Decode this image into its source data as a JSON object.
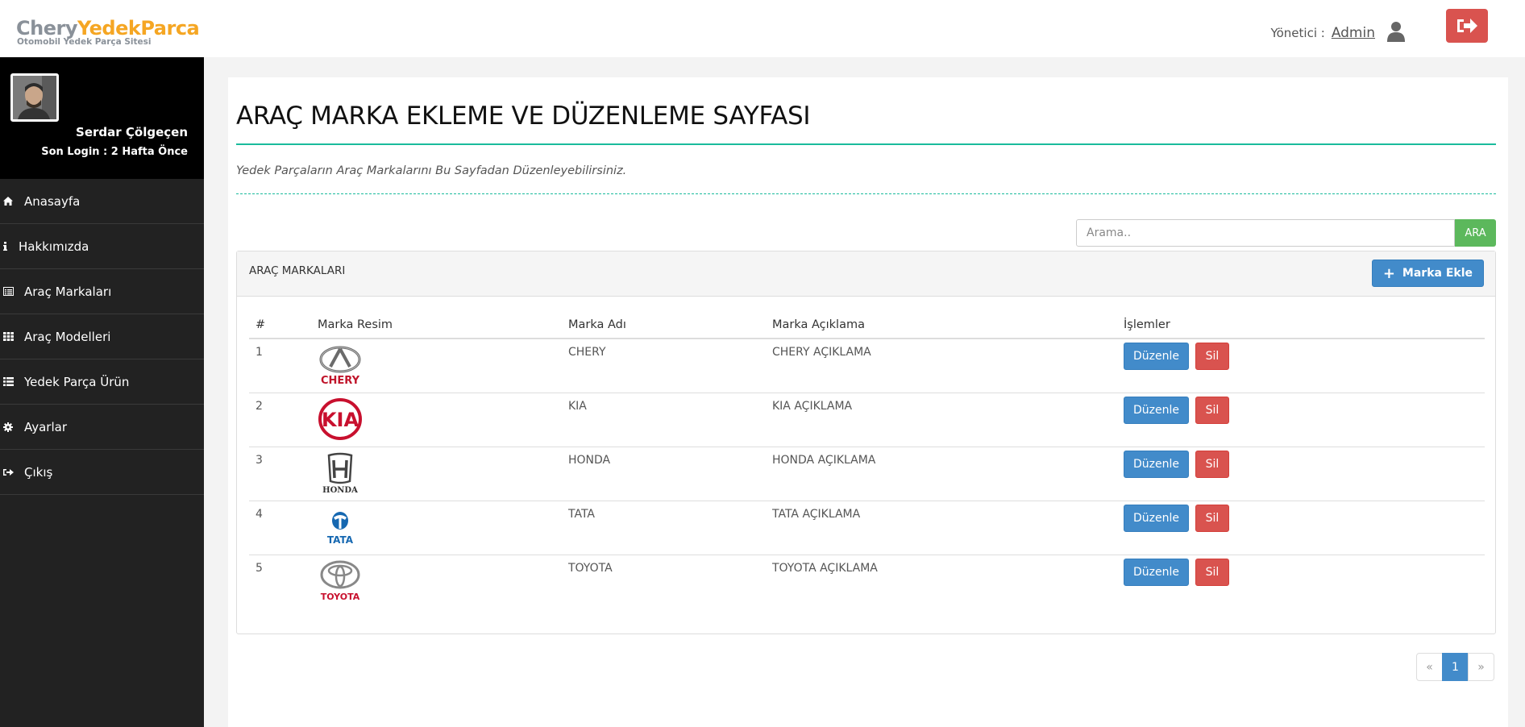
{
  "header": {
    "logo_part1": "Chery",
    "logo_part2": "Yedek",
    "logo_part3": "Parca",
    "logo_sub": "Otomobil Yedek Parça Sitesi",
    "user_label": "Yönetici :",
    "user_name": "Admin"
  },
  "sidebar": {
    "profile_name": "Serdar Çölgeçen",
    "last_login": "Son Login : 2 Hafta Önce",
    "items": [
      {
        "label": "Anasayfa",
        "icon": "home-icon"
      },
      {
        "label": "Hakkımızda",
        "icon": "info-icon"
      },
      {
        "label": "Araç Markaları",
        "icon": "list-alt-icon"
      },
      {
        "label": "Araç Modelleri",
        "icon": "grid-icon"
      },
      {
        "label": "Yedek Parça Ürün",
        "icon": "list-icon"
      },
      {
        "label": "Ayarlar",
        "icon": "cog-icon"
      },
      {
        "label": "Çıkış",
        "icon": "logout-icon"
      }
    ]
  },
  "main": {
    "title": "ARAÇ MARKA EKLEME VE DÜZENLEME SAYFASI",
    "subtitle": "Yedek Parçaların Araç Markalarını Bu Sayfadan Düzenleyebilirsiniz.",
    "search_placeholder": "Arama..",
    "search_button": "ARA",
    "panel_title": "ARAÇ MARKALARI",
    "add_button": "Marka Ekle",
    "table": {
      "headers": [
        "#",
        "Marka Resim",
        "Marka Adı",
        "Marka Açıklama",
        "İşlemler"
      ],
      "rows": [
        {
          "num": "1",
          "logo": "CHERY",
          "name": "CHERY",
          "desc": "CHERY AÇIKLAMA"
        },
        {
          "num": "2",
          "logo": "KIA",
          "name": "KIA",
          "desc": "KIA AÇIKLAMA"
        },
        {
          "num": "3",
          "logo": "HONDA",
          "name": "HONDA",
          "desc": "HONDA AÇIKLAMA"
        },
        {
          "num": "4",
          "logo": "TATA",
          "name": "TATA",
          "desc": "TATA AÇIKLAMA"
        },
        {
          "num": "5",
          "logo": "TOYOTA",
          "name": "TOYOTA",
          "desc": "TOYOTA AÇIKLAMA"
        }
      ],
      "edit_label": "Düzenle",
      "delete_label": "Sil"
    },
    "pagination": {
      "prev": "«",
      "current": "1",
      "next": "»"
    }
  },
  "colors": {
    "accent": "#1abb9c",
    "primary": "#428bca",
    "danger": "#d9534f",
    "success": "#5cb85c",
    "sidebar": "#222222"
  }
}
